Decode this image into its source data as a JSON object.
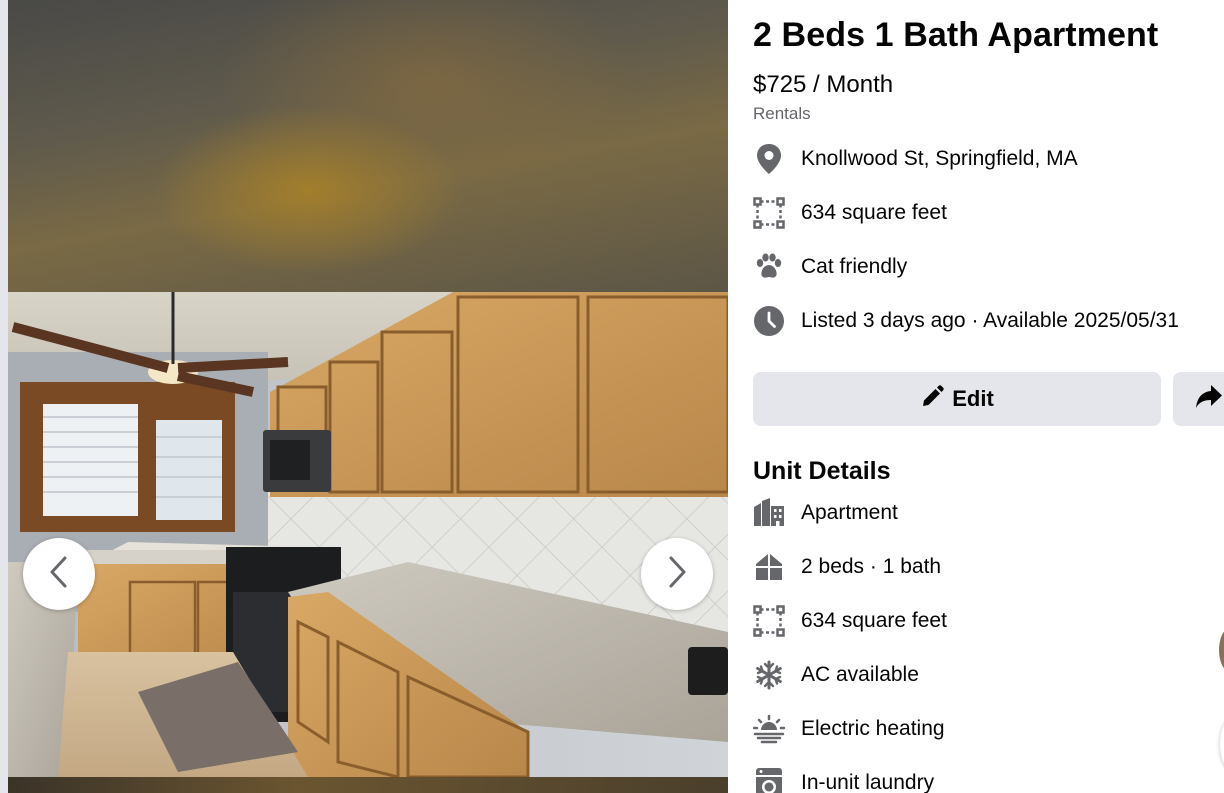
{
  "listing": {
    "title": "2 Beds 1 Bath Apartment",
    "price": "$725 / Month",
    "category": "Rentals"
  },
  "info": [
    {
      "icon": "location-pin-icon",
      "text": "Knollwood St, Springfield, MA"
    },
    {
      "icon": "square-footage-icon",
      "text": "634 square feet"
    },
    {
      "icon": "paw-icon",
      "text": "Cat friendly"
    },
    {
      "icon": "clock-icon",
      "text": "Listed 3 days ago · Available 2025/05/31"
    }
  ],
  "actions": {
    "edit_label": "Edit",
    "share_icon": "share-arrow-icon"
  },
  "unit_details": {
    "title": "Unit Details",
    "items": [
      {
        "icon": "building-icon",
        "text": "Apartment"
      },
      {
        "icon": "house-icon",
        "text": "2 beds · 1 bath"
      },
      {
        "icon": "square-footage-icon",
        "text": "634 square feet"
      },
      {
        "icon": "snowflake-icon",
        "text": "AC available"
      },
      {
        "icon": "heating-icon",
        "text": "Electric heating"
      },
      {
        "icon": "laundry-icon",
        "text": "In-unit laundry"
      }
    ]
  },
  "gallery": {
    "prev_icon": "chevron-left-icon",
    "next_icon": "chevron-right-icon"
  },
  "colors": {
    "icon_gray": "#65676b",
    "button_bg": "#e4e6eb",
    "text_primary": "#050505",
    "text_secondary": "#65676b"
  }
}
